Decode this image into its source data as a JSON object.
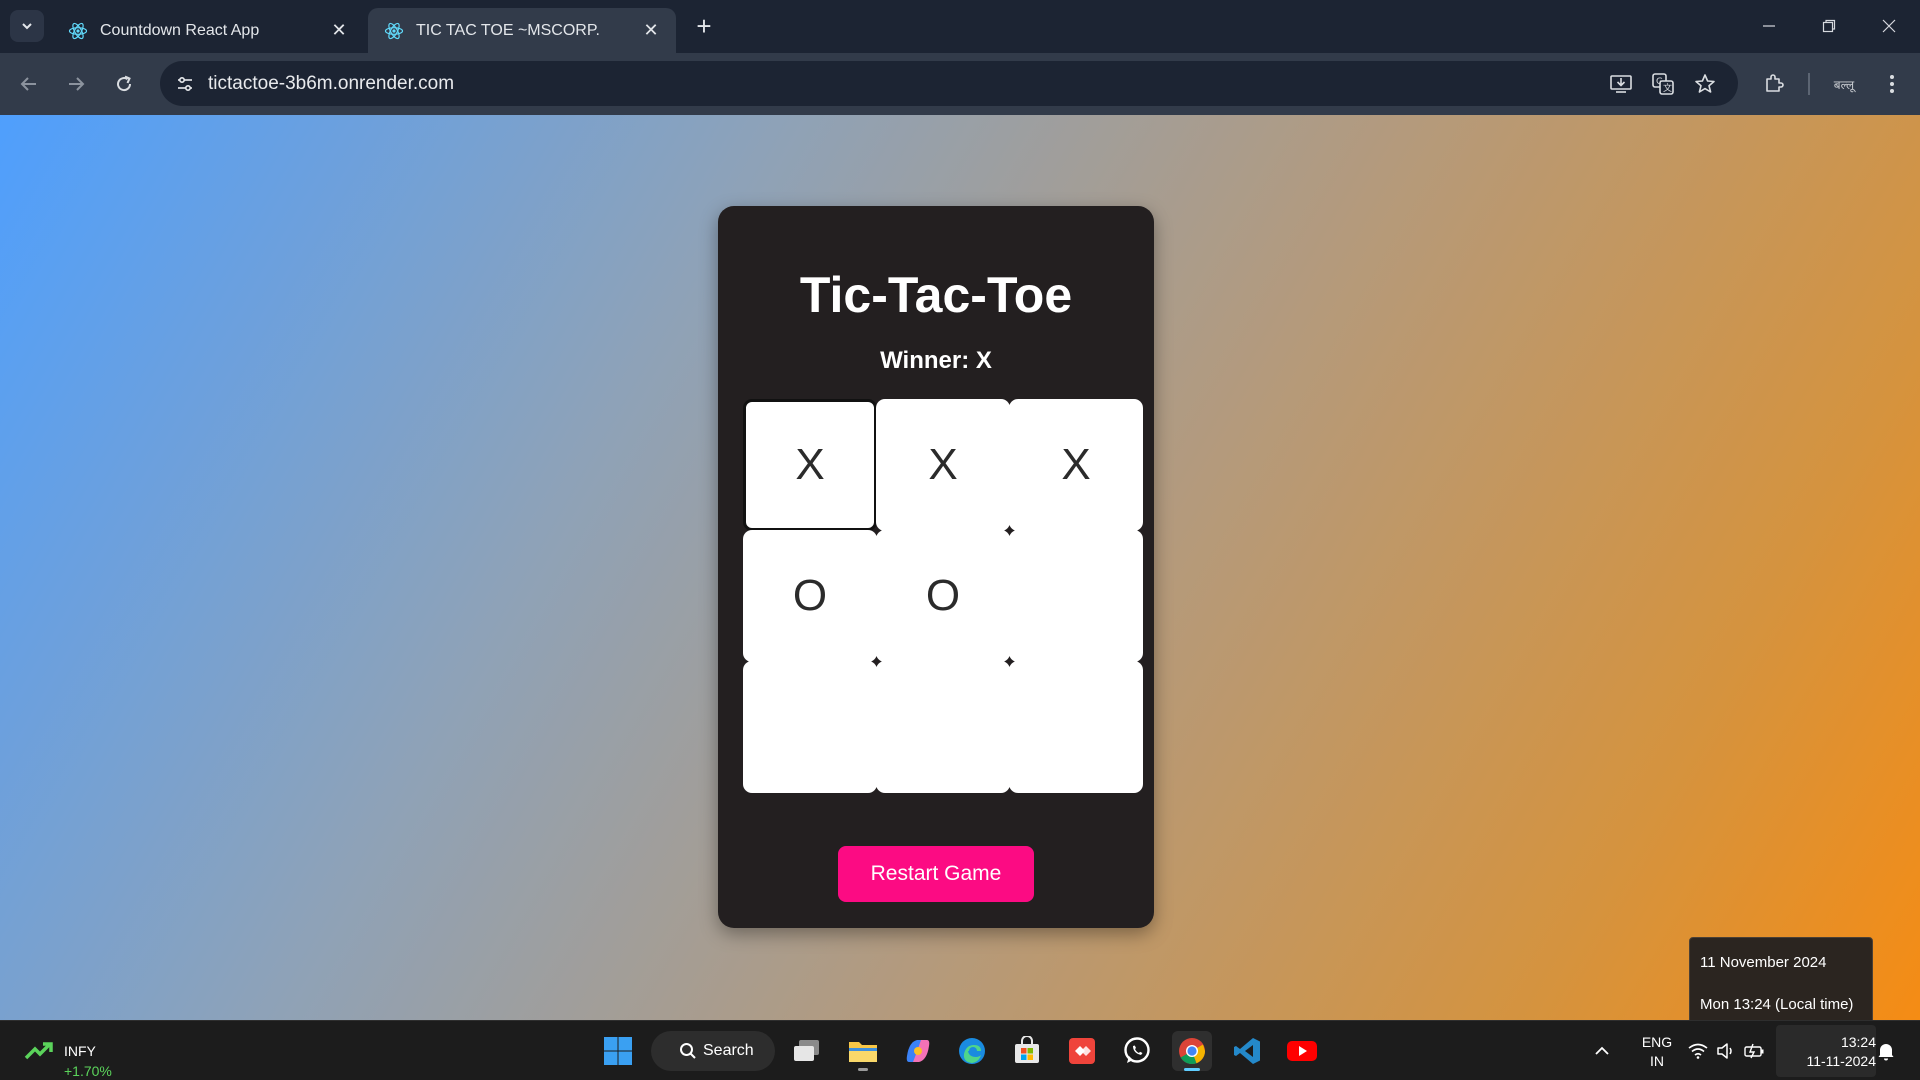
{
  "browser": {
    "tabs": [
      {
        "title": "Countdown React App",
        "active": false
      },
      {
        "title": "TIC TAC TOE ~MSCORP.",
        "active": true
      }
    ],
    "url": "tictactoe-3b6m.onrender.com",
    "profile_label": "बल्लू"
  },
  "game": {
    "title": "Tic-Tac-Toe",
    "status": "Winner: X",
    "board": [
      "X",
      "X",
      "X",
      "O",
      "O",
      "",
      "",
      "",
      ""
    ],
    "restart_label": "Restart Game",
    "colors": {
      "card": "#231f20",
      "restart": "#fc0b83",
      "cell": "#ffffff"
    }
  },
  "datetime_tooltip": {
    "date": "11 November 2024",
    "local": "Mon 13:24 (Local time)"
  },
  "taskbar": {
    "stock": {
      "symbol": "INFY",
      "change": "+1.70%"
    },
    "search_label": "Search",
    "apps": [
      "windows-start",
      "search",
      "task-view",
      "file-explorer",
      "copilot",
      "edge",
      "microsoft-store",
      "anydesk",
      "whatsapp",
      "chrome",
      "vscode",
      "youtube"
    ],
    "language": {
      "line1": "ENG",
      "line2": "IN"
    },
    "clock": {
      "time": "13:24",
      "date": "11-11-2024"
    }
  }
}
